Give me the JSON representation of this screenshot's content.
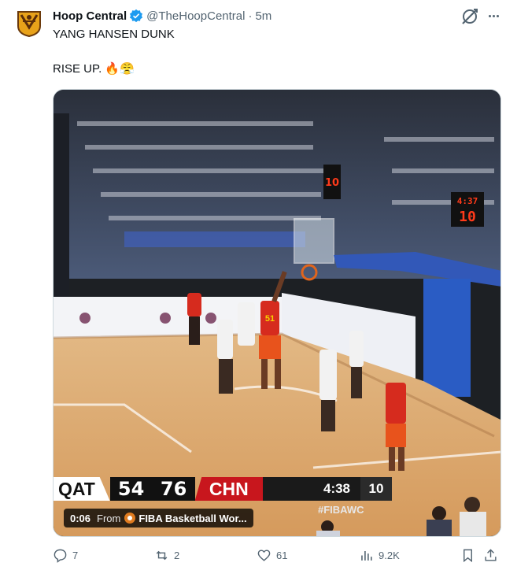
{
  "tweet": {
    "author_name": "Hoop Central",
    "handle": "@TheHoopCentral",
    "separator": "·",
    "time": "5m",
    "text_line1": "YANG HANSEN DUNK",
    "text_line2": "RISE UP. 🔥😤"
  },
  "video": {
    "timestamp": "0:06",
    "from_label": "From",
    "source_name": "FIBA Basketball Wor...",
    "scoreboard": {
      "team_left": "QAT",
      "score_left": "54",
      "score_right": "76",
      "team_right": "CHN",
      "game_clock": "4:38",
      "shot_clock": "10",
      "hashtag": "#FIBAWC"
    },
    "arena_clock_time": "4:37",
    "arena_shot_clock": "10",
    "jersey_number": "51"
  },
  "actions": {
    "reply_count": "7",
    "repost_count": "2",
    "like_count": "61",
    "views_count": "9.2K"
  },
  "colors": {
    "verified_blue": "#1d9bf0",
    "text_secondary": "#536471",
    "china_red": "#c8161d"
  },
  "icons": [
    "avatar-logo",
    "verified-badge-icon",
    "grok-icon",
    "more-icon",
    "reply-icon",
    "repost-icon",
    "like-icon",
    "views-icon",
    "bookmark-icon",
    "share-icon"
  ]
}
